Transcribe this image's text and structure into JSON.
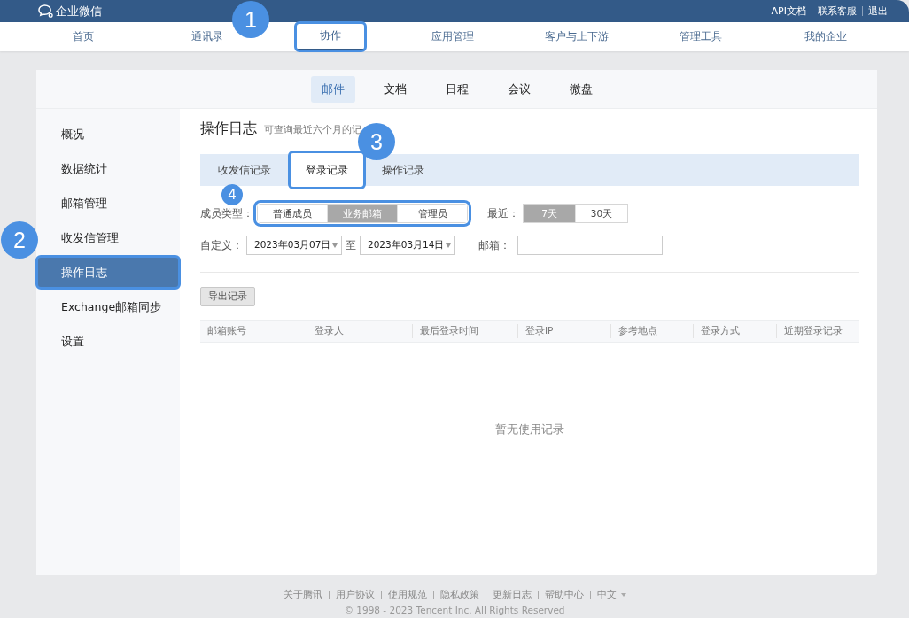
{
  "header": {
    "logo_text": "企业微信",
    "links": [
      "API文档",
      "联系客服",
      "退出"
    ]
  },
  "nav": [
    {
      "label": "首页",
      "selected": false,
      "highlighted": false
    },
    {
      "label": "通讯录",
      "selected": false,
      "highlighted": false
    },
    {
      "label": "协作",
      "selected": true,
      "highlighted": true
    },
    {
      "label": "应用管理",
      "selected": false,
      "highlighted": false
    },
    {
      "label": "客户与上下游",
      "selected": false,
      "highlighted": false
    },
    {
      "label": "管理工具",
      "selected": false,
      "highlighted": false
    },
    {
      "label": "我的企业",
      "selected": false,
      "highlighted": false
    }
  ],
  "subnav": [
    {
      "label": "邮件",
      "selected": true
    },
    {
      "label": "文档",
      "selected": false
    },
    {
      "label": "日程",
      "selected": false
    },
    {
      "label": "会议",
      "selected": false
    },
    {
      "label": "微盘",
      "selected": false
    }
  ],
  "sidebar": {
    "items": [
      {
        "label": "概况",
        "selected": false,
        "highlighted": false
      },
      {
        "label": "数据统计",
        "selected": false,
        "highlighted": false
      },
      {
        "label": "邮箱管理",
        "selected": false,
        "highlighted": false
      },
      {
        "label": "收发信管理",
        "selected": false,
        "highlighted": false
      },
      {
        "label": "操作日志",
        "selected": true,
        "highlighted": true
      },
      {
        "label": "Exchange邮箱同步",
        "selected": false,
        "highlighted": false
      },
      {
        "label": "设置",
        "selected": false,
        "highlighted": false
      }
    ]
  },
  "content": {
    "title": "操作日志",
    "subtitle": "可查询最近六个月的记",
    "tabs": [
      {
        "label": "收发信记录",
        "selected": false,
        "highlighted": false
      },
      {
        "label": "登录记录",
        "selected": true,
        "highlighted": true
      },
      {
        "label": "操作记录",
        "selected": false,
        "highlighted": false
      }
    ],
    "member_type": {
      "label": "成员类型：",
      "highlighted": true,
      "options": [
        {
          "label": "普通成员",
          "selected": false
        },
        {
          "label": "业务邮箱",
          "selected": true
        },
        {
          "label": "管理员",
          "selected": false
        }
      ]
    },
    "recent": {
      "label": "最近：",
      "options": [
        {
          "label": "7天",
          "selected": true
        },
        {
          "label": "30天",
          "selected": false
        }
      ]
    },
    "custom": {
      "label": "自定义：",
      "from": "2023年03月07日",
      "to_label": "至",
      "to": "2023年03月14日"
    },
    "mailbox": {
      "label": "邮箱："
    },
    "export_button": "导出记录",
    "table": {
      "columns": [
        "邮箱账号",
        "登录人",
        "最后登录时间",
        "登录IP",
        "参考地点",
        "登录方式",
        "近期登录记录"
      ],
      "empty_text": "暂无使用记录"
    }
  },
  "footer": {
    "links": [
      "关于腾讯",
      "用户协议",
      "使用规范",
      "隐私政策",
      "更新日志",
      "帮助中心"
    ],
    "language": "中文",
    "copyright": "© 1998 - 2023 Tencent Inc. All Rights Reserved"
  },
  "annotations": [
    {
      "label": "1"
    },
    {
      "label": "2"
    },
    {
      "label": "3"
    },
    {
      "label": "4"
    }
  ]
}
